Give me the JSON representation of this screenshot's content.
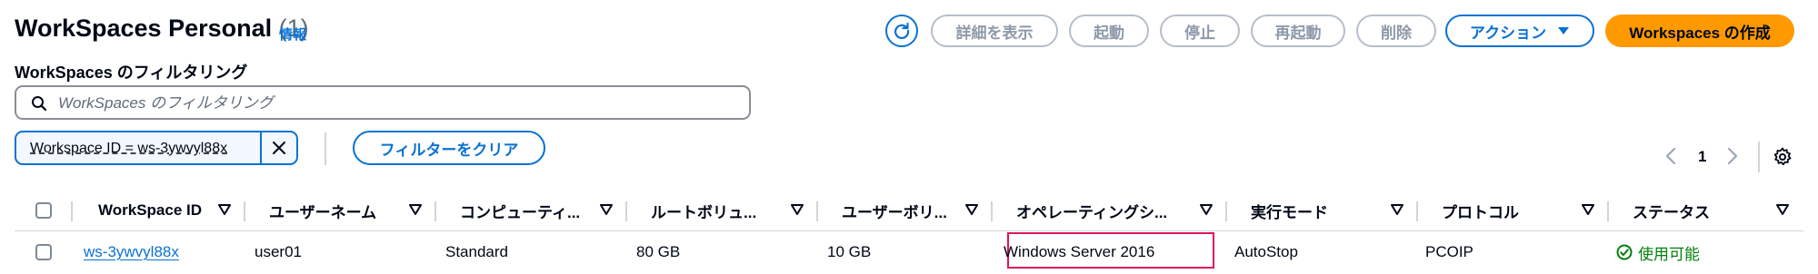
{
  "header": {
    "title": "WorkSpaces Personal",
    "count": "(1)",
    "info_link": "情報"
  },
  "toolbar": {
    "view_details": "詳細を表示",
    "start": "起動",
    "stop": "停止",
    "reboot": "再起動",
    "delete": "削除",
    "actions": "アクション",
    "create": "Workspaces の作成"
  },
  "filter": {
    "label": "WorkSpaces のフィルタリング",
    "placeholder": "WorkSpaces のフィルタリング",
    "token": "Workspace ID = ws-3ywvyl88x",
    "clear": "フィルターをクリア"
  },
  "pagination": {
    "current_page": "1"
  },
  "table": {
    "columns": [
      "WorkSpace ID",
      "ユーザーネーム",
      "コンピューティ...",
      "ルートボリュ...",
      "ユーザーボリ...",
      "オペレーティングシ...",
      "実行モード",
      "プロトコル",
      "ステータス"
    ],
    "rows": [
      {
        "workspace_id": "ws-3ywvyl88x",
        "username": "user01",
        "compute": "Standard",
        "root_volume": "80 GB",
        "user_volume": "10 GB",
        "os": "Windows Server 2016",
        "running_mode": "AutoStop",
        "protocol": "PCOIP",
        "status": "使用可能"
      }
    ]
  },
  "colors": {
    "accent": "#0972d3",
    "primary_button": "#ff9900",
    "status_ok": "#037f0c",
    "highlight_box": "#e0115f"
  }
}
